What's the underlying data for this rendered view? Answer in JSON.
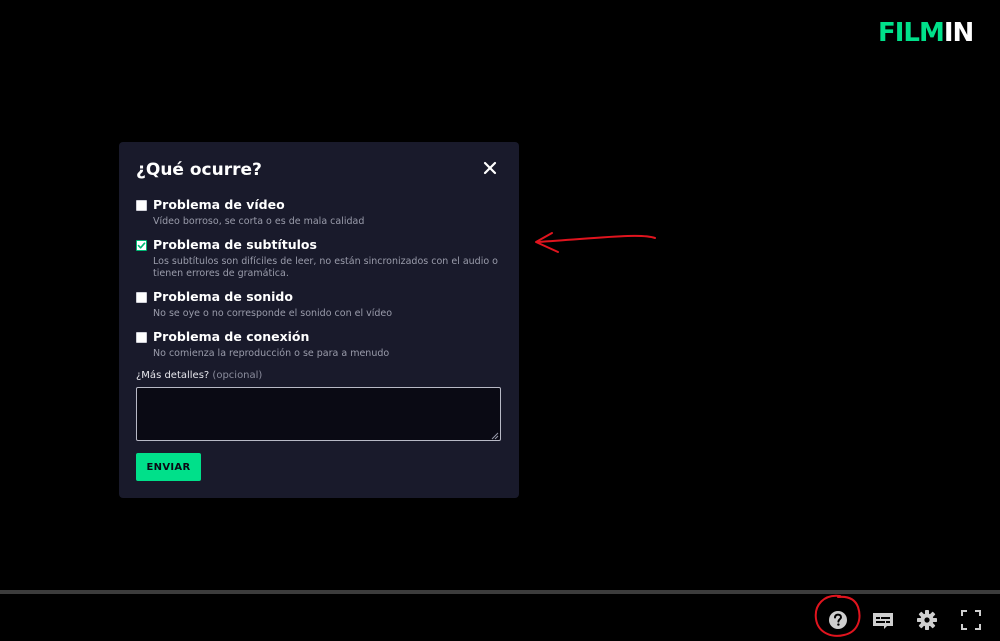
{
  "app": {
    "logo_part1": "FILM",
    "logo_part2": "IN"
  },
  "colors": {
    "accent": "#00e08a",
    "modal_bg": "#191a2b",
    "annotation": "#e0141e"
  },
  "report_dialog": {
    "title": "¿Qué ocurre?",
    "close_icon": "close-icon",
    "options": [
      {
        "label": "Problema de vídeo",
        "description": "Vídeo borroso, se corta o es de mala calidad",
        "checked": false
      },
      {
        "label": "Problema de subtítulos",
        "description": "Los subtítulos son difíciles de leer, no están sincronizados con el audio o tienen errores de gramática.",
        "checked": true
      },
      {
        "label": "Problema de sonido",
        "description": "No se oye o no corresponde el sonido con el vídeo",
        "checked": false
      },
      {
        "label": "Problema de conexión",
        "description": "No comienza la reproducción o se para a menudo",
        "checked": false
      }
    ],
    "details_label": "¿Más detalles?",
    "details_optional": "(opcional)",
    "details_value": "",
    "send_label": "ENVIAR"
  },
  "player_controls": {
    "progress": 0,
    "icons": [
      "help-icon",
      "subtitles-icon",
      "settings-icon",
      "fullscreen-icon"
    ]
  }
}
